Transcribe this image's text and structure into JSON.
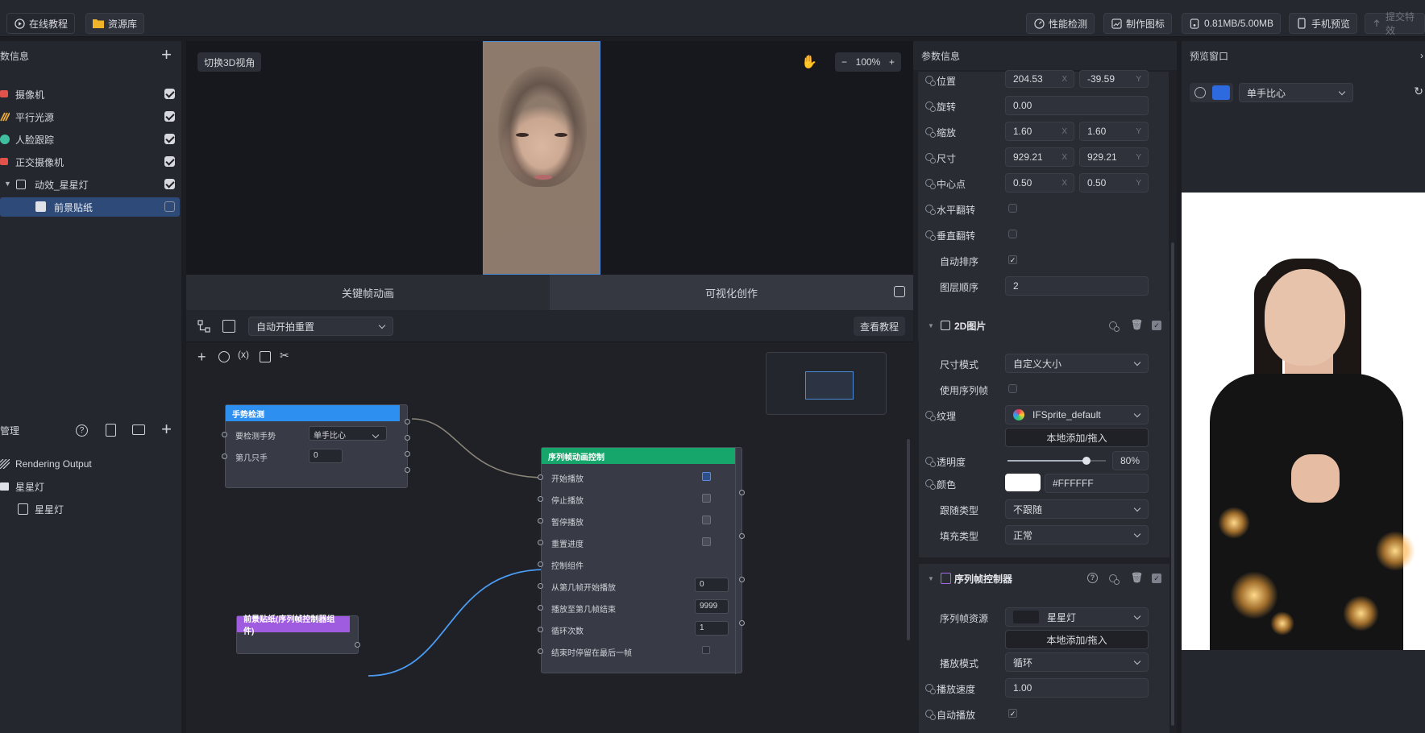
{
  "topbar": {
    "tutorial": "在线教程",
    "library": "资源库",
    "perf": "性能检测",
    "make_icon": "制作图标",
    "size": "0.81MB/5.00MB",
    "phone_preview": "手机预览",
    "submit": "提交特效"
  },
  "left": {
    "scene_title": "数信息",
    "items": [
      {
        "label": "摄像机",
        "icon_color": "#e2524a",
        "checked": true
      },
      {
        "label": "平行光源",
        "icon_color": "#e9a93b",
        "checked": true
      },
      {
        "label": "人脸跟踪",
        "icon_color": "#3fbf9f",
        "checked": true
      },
      {
        "label": "正交摄像机",
        "icon_color": "#e2524a",
        "checked": true
      },
      {
        "label": "动效_星星灯",
        "icon_color": "#cfd2d9",
        "checked": true
      },
      {
        "label": "前景贴纸",
        "icon_color": "#cfd2d9",
        "checked": false
      }
    ],
    "assets_title": "管理",
    "assets": [
      {
        "label": "Rendering Output"
      },
      {
        "label": "星星灯"
      },
      {
        "label": "星星灯"
      }
    ]
  },
  "viewport": {
    "btn_3d": "切换3D视角",
    "zoom": "100%"
  },
  "tabs": {
    "keyframe": "关键帧动画",
    "visual": "可视化创作"
  },
  "graph_toolbar": {
    "trigger_select": "自动开拍重置",
    "tutorial": "查看教程"
  },
  "nodes": {
    "gesture": {
      "title": "手势检测",
      "row1": "要检测手势",
      "row1_value": "单手比心",
      "row2": "第几只手",
      "row2_value": "0"
    },
    "seq": {
      "title": "序列帧动画控制",
      "rows": [
        "开始播放",
        "停止播放",
        "暂停播放",
        "重置进度",
        "控制组件",
        "从第几帧开始播放",
        "播放至第几帧结束",
        "循环次数",
        "结束时停留在最后一帧"
      ],
      "values": {
        "start_frame": "0",
        "end_frame": "9999",
        "loops": "1"
      }
    },
    "sticker": {
      "title": "前景贴纸(序列帧控制器组件)"
    }
  },
  "params": {
    "title": "参数信息",
    "position": {
      "label": "位置",
      "x": "204.53",
      "y": "-39.59"
    },
    "rotation": {
      "label": "旋转",
      "value": "0.00"
    },
    "scale": {
      "label": "缩放",
      "x": "1.60",
      "y": "1.60"
    },
    "size": {
      "label": "尺寸",
      "x": "929.21",
      "y": "929.21"
    },
    "pivot": {
      "label": "中心点",
      "x": "0.50",
      "y": "0.50"
    },
    "flip_h": {
      "label": "水平翻转",
      "checked": false
    },
    "flip_v": {
      "label": "垂直翻转",
      "checked": false
    },
    "auto_sort": {
      "label": "自动排序",
      "checked": true
    },
    "layer_order": {
      "label": "图层顺序",
      "value": "2"
    },
    "img2d": {
      "title": "2D图片",
      "size_mode_label": "尺寸模式",
      "size_mode": "自定义大小",
      "use_seq_label": "使用序列帧",
      "texture_label": "纹理",
      "texture": "IFSprite_default",
      "add_local": "本地添加/拖入",
      "opacity_label": "透明度",
      "opacity": "80%",
      "opacity_fraction": 0.8,
      "color_label": "颜色",
      "color": "#FFFFFF",
      "follow_label": "跟随类型",
      "follow": "不跟随",
      "fill_label": "填充类型",
      "fill": "正常"
    },
    "seqctl": {
      "title": "序列帧控制器",
      "res_label": "序列帧资源",
      "res": "星星灯",
      "add_local": "本地添加/拖入",
      "mode_label": "播放模式",
      "mode": "循环",
      "speed_label": "播放速度",
      "speed": "1.00",
      "autoplay_label": "自动播放"
    }
  },
  "preview": {
    "title": "预览窗口",
    "gesture": "单手比心"
  },
  "axis": {
    "x": "X",
    "y": "Y"
  }
}
